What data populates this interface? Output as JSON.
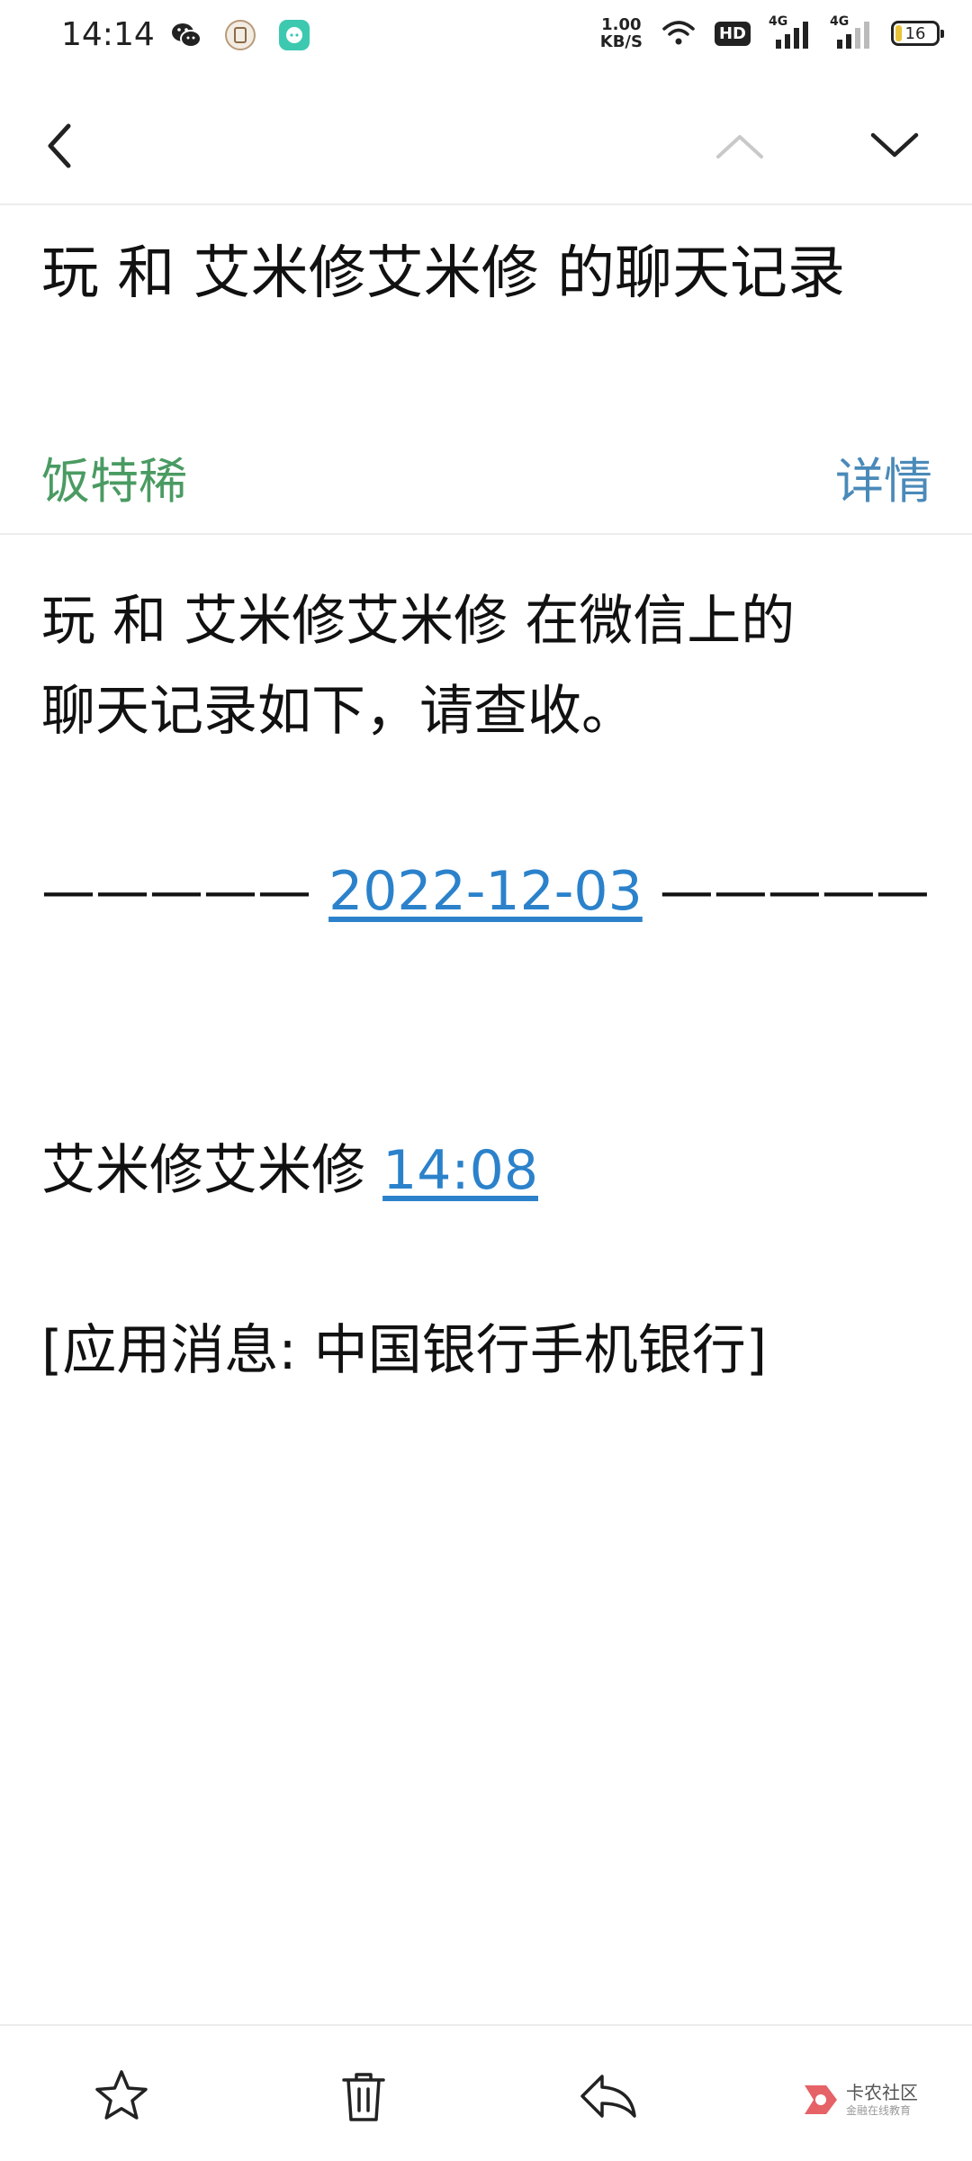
{
  "status_bar": {
    "time": "14:14",
    "net_speed_value": "1.00",
    "net_speed_unit": "KB/S",
    "hd_label": "HD",
    "signal_1_label": "4G",
    "signal_2_label": "4G",
    "battery_level": "16",
    "icons": [
      "wechat-icon",
      "app-icon",
      "chat-app-icon",
      "wifi-icon"
    ]
  },
  "nav": {
    "back_icon": "chevron-left-icon",
    "prev_icon": "chevron-up-icon",
    "next_icon": "chevron-down-icon"
  },
  "email": {
    "subject": "玩 和 艾米修艾米修 的聊天记录",
    "sender": "饭特稀",
    "details_link": "详情",
    "body": {
      "intro_line_1": "玩 和 艾米修艾米修 在微信上的",
      "intro_line_2": "聊天记录如下，请查收。",
      "date_dashes_left": "—————",
      "date": "2022-12-03",
      "date_dashes_right": "—————",
      "message_sender": "艾米修艾米修",
      "message_time": "14:08",
      "message_content": "[应用消息: 中国银行手机银行]"
    }
  },
  "bottom_bar": {
    "actions": [
      "star-icon",
      "trash-icon",
      "reply-icon"
    ],
    "watermark_title": "卡农社区",
    "watermark_sub": "金融在线教育"
  },
  "colors": {
    "sender_green": "#4a9b62",
    "details_blue": "#4a8ab9",
    "link_blue": "#2b82cb"
  }
}
